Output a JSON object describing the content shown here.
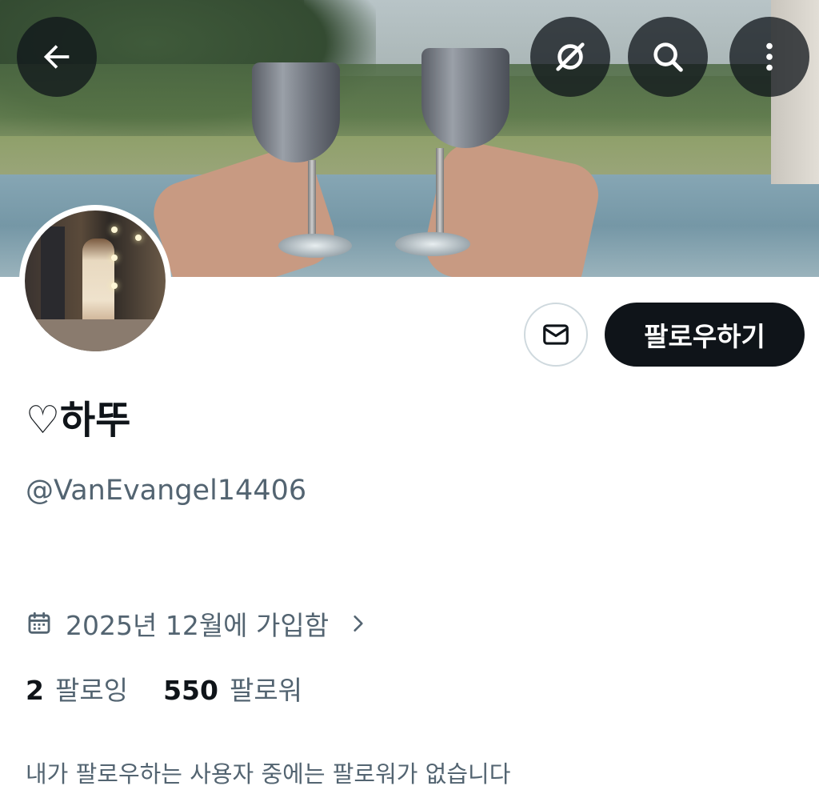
{
  "header": {
    "back_icon": "arrow-left-icon",
    "grok_icon": "slashed-circle-icon",
    "search_icon": "search-icon",
    "more_icon": "vertical-dots-icon"
  },
  "profile": {
    "display_name": "♡하뚜",
    "handle": "@VanEvangel14406",
    "joined": "2025년 12월에 가입함",
    "following_count": "2",
    "following_label": "팔로잉",
    "followers_count": "550",
    "followers_label": "팔로워",
    "mutuals_note": "내가 팔로우하는 사용자 중에는 팔로워가 없습니다"
  },
  "actions": {
    "follow_label": "팔로우하기",
    "message_icon": "envelope-icon"
  },
  "colors": {
    "primary_text": "#0f1419",
    "secondary_text": "#536471",
    "button_bg": "#0f1419",
    "border": "#cfd9de"
  }
}
